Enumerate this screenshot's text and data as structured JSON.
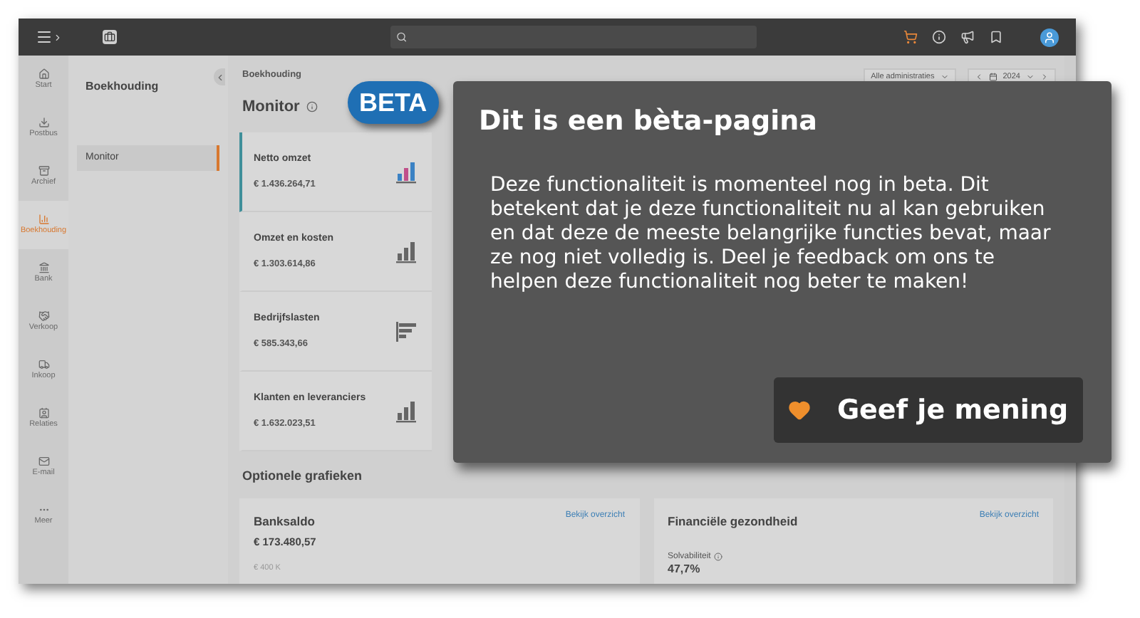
{
  "rail": [
    {
      "label": "Start",
      "selected": false
    },
    {
      "label": "Postbus",
      "selected": false
    },
    {
      "label": "Archief",
      "selected": false
    },
    {
      "label": "Boekhouding",
      "selected": true
    },
    {
      "label": "Bank",
      "selected": false
    },
    {
      "label": "Verkoop",
      "selected": false
    },
    {
      "label": "Inkoop",
      "selected": false
    },
    {
      "label": "Relaties",
      "selected": false
    },
    {
      "label": "E-mail",
      "selected": false
    },
    {
      "label": "Meer",
      "selected": false
    }
  ],
  "subnav": {
    "title": "Boekhouding",
    "items": [
      {
        "label": "Monitor",
        "selected": true
      }
    ]
  },
  "header": {
    "breadcrumb": "Boekhouding",
    "title": "Monitor",
    "badge": "BETA",
    "administration": "Alle administraties",
    "year": "2024"
  },
  "kpis": [
    {
      "label": "Netto omzet",
      "value": "€ 1.436.264,71",
      "kind": "bar",
      "selected": true
    },
    {
      "label": "Omzet en kosten",
      "value": "€ 1.303.614,86",
      "kind": "bar",
      "selected": false
    },
    {
      "label": "Bedrijfslasten",
      "value": "€ 585.343,66",
      "kind": "hbar",
      "selected": false
    },
    {
      "label": "Klanten en leveranciers",
      "value": "€ 1.632.023,51",
      "kind": "bar",
      "selected": false
    }
  ],
  "optional": {
    "title": "Optionele grafieken",
    "panels": [
      {
        "title": "Banksaldo",
        "value": "€ 173.480,57",
        "link": "Bekijk overzicht",
        "axis_label": "€ 400 K"
      },
      {
        "title": "Financiële gezondheid",
        "link": "Bekijk overzicht",
        "metric_label": "Solvabiliteit",
        "metric_value": "47,7%"
      }
    ]
  },
  "dialog": {
    "title": "Dit is een bèta-pagina",
    "body": "Deze functionaliteit is momenteel nog in beta. Dit betekent dat je deze functionaliteit nu al kan gebruiken en dat deze de meeste belangrijke functies bevat, maar ze nog niet volledig is. Deel je feedback om ons te helpen deze functionaliteit nog beter te maken!",
    "button": "Geef je mening"
  }
}
